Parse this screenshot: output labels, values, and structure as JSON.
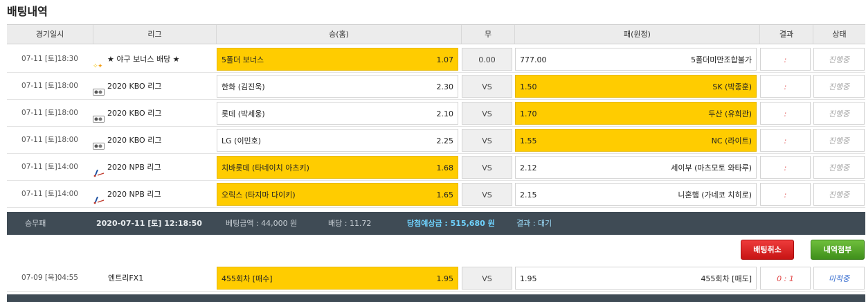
{
  "title": "배팅내역",
  "headers": {
    "time": "경기일시",
    "league": "리그",
    "home": "승(홈)",
    "draw": "무",
    "away": "패(원정)",
    "result": "결과",
    "status": "상태"
  },
  "rows": [
    {
      "time": "07-11 [토]18:30",
      "league": "★ 야구 보너스 배당 ★",
      "league_icon": "star-icon",
      "home_name": "5폴더 보너스",
      "home_odd": "1.07",
      "draw": "0.00",
      "away_odd": "777.00",
      "away_name": "5폴더미만조합불가",
      "result": ":",
      "status": "진행중",
      "selected": "home"
    },
    {
      "time": "07-11 [토]18:00",
      "league": "2020 KBO 리그",
      "league_icon": "kbo-logo-icon",
      "home_name": "한화 (김진욱)",
      "home_odd": "2.30",
      "draw": "VS",
      "away_odd": "1.50",
      "away_name": "SK (박종훈)",
      "result": ":",
      "status": "진행중",
      "selected": "away"
    },
    {
      "time": "07-11 [토]18:00",
      "league": "2020 KBO 리그",
      "league_icon": "kbo-logo-icon",
      "home_name": "롯데 (박세웅)",
      "home_odd": "2.10",
      "draw": "VS",
      "away_odd": "1.70",
      "away_name": "두산 (유희관)",
      "result": ":",
      "status": "진행중",
      "selected": "away"
    },
    {
      "time": "07-11 [토]18:00",
      "league": "2020 KBO 리그",
      "league_icon": "kbo-logo-icon",
      "home_name": "LG (이민호)",
      "home_odd": "2.25",
      "draw": "VS",
      "away_odd": "1.55",
      "away_name": "NC (라이트)",
      "result": ":",
      "status": "진행중",
      "selected": "away"
    },
    {
      "time": "07-11 [토]14:00",
      "league": "2020 NPB 리그",
      "league_icon": "npb-logo-icon",
      "home_name": "치바롯데 (타네이치 아츠키)",
      "home_odd": "1.68",
      "draw": "VS",
      "away_odd": "2.12",
      "away_name": "세이부 (마츠모토 와타루)",
      "result": ":",
      "status": "진행중",
      "selected": "home"
    },
    {
      "time": "07-11 [토]14:00",
      "league": "2020 NPB 리그",
      "league_icon": "npb-logo-icon",
      "home_name": "오릭스 (타지마 다이키)",
      "home_odd": "1.65",
      "draw": "VS",
      "away_odd": "2.15",
      "away_name": "니혼햄 (가네코 치히로)",
      "result": ":",
      "status": "진행중",
      "selected": "home"
    }
  ],
  "summary": {
    "type": "승무패",
    "date": "2020-07-11 [토] 12:18:50",
    "amount": "베팅금액 : 44,000 원",
    "odds": "배당 : 11.72",
    "win": "당첨예상금 : 515,680 원",
    "result": "결과 : 대기"
  },
  "buttons": {
    "cancel": "배팅취소",
    "attach": "내역첨부"
  },
  "row2": {
    "time": "07-09 [목]04:55",
    "league": "엔트리FX1",
    "home_name": "455회차 [매수]",
    "home_odd": "1.95",
    "draw": "VS",
    "away_odd": "1.95",
    "away_name": "455회차 [매도]",
    "result": "0 : 1",
    "status": "미적중"
  },
  "colors": {
    "selected": "#ffcc00",
    "summary_bg": "#3f4b55",
    "cancel": "#d42020",
    "attach": "#4f9f25"
  }
}
